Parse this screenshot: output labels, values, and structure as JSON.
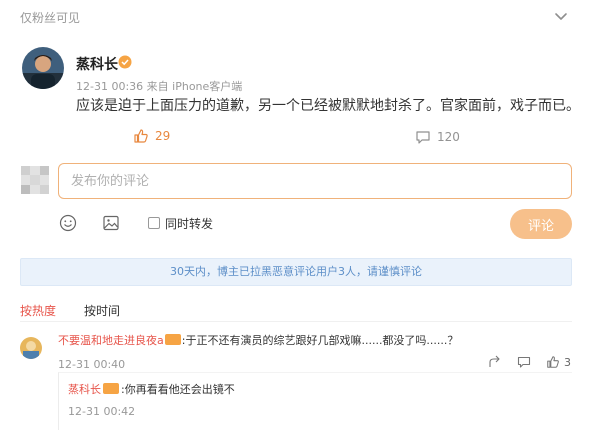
{
  "post": {
    "visibility": "仅粉丝可见",
    "author": "蒸科长",
    "timestamp": "12-31 00:36",
    "source": "来自 iPhone客户端",
    "content": "应该是迫于上面压力的道歉，另一个已经被默默地封杀了。官家面前，戏子而已。",
    "likes": "29",
    "comments": "120"
  },
  "composer": {
    "placeholder": "发布你的评论",
    "repost_label": "同时转发",
    "submit_label": "评论"
  },
  "notice": "30天内，博主已拉黑恶意评论用户3人，请谨慎评论",
  "sort_tabs": [
    "按热度",
    "按时间"
  ],
  "comments": [
    {
      "user": "不要温和地走进良夜a",
      "text": ":于正不还有演员的综艺跟好几部戏嘛......都没了吗......？",
      "time": "12-31 00:40",
      "likes": "3",
      "replies": [
        {
          "user": "蒸科长",
          "text": ":你再看看他还会出镜不",
          "time": "12-31 00:42"
        }
      ]
    }
  ],
  "colors": {
    "accent_orange": "#e8883f",
    "username_red": "#e7554b",
    "notice_blue": "#5d8fc8",
    "input_border": "#f0b27a",
    "submit_bg": "#f7c08b"
  }
}
